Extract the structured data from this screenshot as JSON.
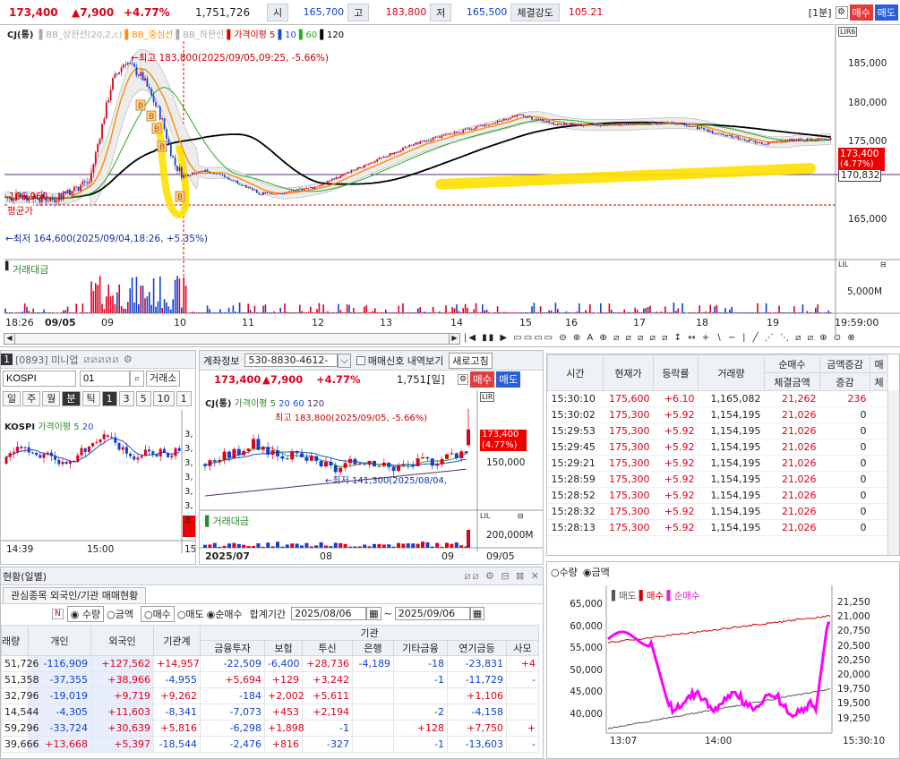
{
  "topbar": {
    "price": "173,400",
    "change": "▲7,900",
    "rate": "+4.77%",
    "volume": "1,751,726",
    "open_label": "시",
    "open": "165,700",
    "high_label": "고",
    "high": "183,800",
    "low_label": "저",
    "low": "165,500",
    "strength_label": "체결강도",
    "strength": "105.21",
    "period": "[1분]",
    "sell_button": "매수",
    "buy_button": "매도"
  },
  "main_chart": {
    "legend_name": "CJ(통)",
    "legend_items": [
      "BB_상한선(20,2,c)",
      "BB_중심선",
      "BB_하한선",
      "가격이평 5",
      "10",
      "60",
      "120"
    ],
    "legend_colors": [
      "#aaaaaa",
      "#ff8c00",
      "#aaaaaa",
      "#e00000",
      "#1a4fd6",
      "#22aa22",
      "#000000"
    ],
    "high_annotation": "←최고 183,800(2025/09/05,09:25, -5.66%)",
    "low_annotation": "←최저 164,600(2025/09/04,18:26, +5.35%)",
    "avg_label": "평균가",
    "price_label_left": "166,960",
    "current_tag": "173,400",
    "current_tag_rate": "(4.77%)",
    "line_tag": "170,832",
    "y_ticks": [
      "185,000",
      "180,000",
      "175,000",
      "165,000"
    ],
    "volume_label": "거래대금",
    "volume_tick": "5,000M",
    "x_labels": [
      "18:26",
      "09/05",
      "09",
      "10",
      "11",
      "12",
      "13",
      "14",
      "15",
      "16",
      "17",
      "18",
      "19",
      "19:59:00"
    ]
  },
  "mini_panel": {
    "title_code": "1",
    "title": "[0893] 미니업",
    "index_input": "KOSPI",
    "code_input": "01",
    "exchange": "거래소",
    "periods": [
      "일",
      "주",
      "월",
      "분",
      "틱",
      "1",
      "3",
      "5",
      "10",
      "1"
    ],
    "legend": "KOSPI",
    "legend_ma": "가격이평 5",
    "legend_ma2": "20",
    "y_values": [
      "3,",
      "3,",
      "3,",
      "3,",
      "3,",
      "3,",
      "3,"
    ],
    "tag": "3,",
    "x_labels": [
      "14:39",
      "15:00",
      "15"
    ]
  },
  "daily_chart": {
    "account_label": "계좌정보",
    "account_number": "530-8830-4612-",
    "signal_checkbox": "매매신호 내역보기",
    "refresh_button": "새로고침",
    "price": "173,400",
    "change": "▲7,900",
    "rate": "+4.77%",
    "volume": "1,751,",
    "period": "[일]",
    "buy": "매수",
    "sell": "매도",
    "legend_name": "CJ(통)",
    "legend_ma": "가격이평 5",
    "legend_ma_vals": [
      "20",
      "60",
      "120"
    ],
    "high_annotation": "최고 183,800(2025/09/05, -5.66%)",
    "low_annotation": "←최저 141,300(2025/08/04,",
    "tag": "173,400",
    "tag_rate": "(4.77%)",
    "y_tick": "150,000",
    "volume_label": "거래대금",
    "volume_tick": "200,000M",
    "x_labels": [
      "2025/07",
      "08",
      "09",
      "09/05"
    ]
  },
  "trade_table": {
    "headers": [
      "시간",
      "현재가",
      "등락률",
      "거래량",
      "순매수",
      "금액증감",
      "매"
    ],
    "subheaders": [
      "체결금액",
      "증감",
      "체"
    ],
    "rows": [
      [
        "15:30:10",
        "175,600",
        "+6.10",
        "1,165,082",
        "21,262",
        "236"
      ],
      [
        "15:30:02",
        "175,300",
        "+5.92",
        "1,154,195",
        "21,026",
        "0"
      ],
      [
        "15:29:53",
        "175,300",
        "+5.92",
        "1,154,195",
        "21,026",
        "0"
      ],
      [
        "15:29:45",
        "175,300",
        "+5.92",
        "1,154,195",
        "21,026",
        "0"
      ],
      [
        "15:29:21",
        "175,300",
        "+5.92",
        "1,154,195",
        "21,026",
        "0"
      ],
      [
        "15:28:59",
        "175,300",
        "+5.92",
        "1,154,195",
        "21,026",
        "0"
      ],
      [
        "15:28:52",
        "175,300",
        "+5.92",
        "1,154,195",
        "21,026",
        "0"
      ],
      [
        "15:28:32",
        "175,300",
        "+5.92",
        "1,154,195",
        "21,026",
        "0"
      ],
      [
        "15:28:13",
        "175,300",
        "+5.92",
        "1,154,195",
        "21,026",
        "0"
      ]
    ]
  },
  "flow_chart": {
    "radio_qty": "수량",
    "radio_amount": "금액",
    "legend": [
      "매도",
      "매수",
      "순매수"
    ],
    "left_ticks": [
      "65,000",
      "60,000",
      "55,000",
      "50,000",
      "45,000",
      "40,000"
    ],
    "right_ticks": [
      "21,250",
      "21,000",
      "20,750",
      "20,500",
      "20,250",
      "20,000",
      "19,750",
      "19,500",
      "19,250"
    ],
    "x_labels": [
      "13:07",
      "14:00",
      "15:30:10"
    ]
  },
  "investor_panel": {
    "title": "현황(일별)",
    "tab": "관심종목 외국인/기관 매매현황",
    "radio_qty": "수량",
    "radio_amount": "금액",
    "radio_buy": "매수",
    "radio_sell": "매도",
    "radio_net": "순매수",
    "period_label": "합계기간",
    "date_from": "2025/08/06",
    "date_to": "2025/09/06",
    "headers": [
      "래량",
      "개인",
      "외국인",
      "기관계",
      "금융투자",
      "보험",
      "투신",
      "은행",
      "기타금융",
      "연기금등",
      "사모"
    ],
    "group_header": "기관",
    "rows": [
      [
        "51,726",
        "-116,909",
        "+127,562",
        "+14,957",
        "-22,509",
        "-6,400",
        "+28,736",
        "-4,189",
        "-18",
        "-23,831",
        "+4"
      ],
      [
        "51,358",
        "-37,355",
        "+38,966",
        "-4,955",
        "+5,694",
        "+129",
        "+3,242",
        "",
        "-1",
        "-11,729",
        "-"
      ],
      [
        "32,796",
        "-19,019",
        "+9,719",
        "+9,262",
        "-184",
        "+2,002",
        "+5,611",
        "",
        "",
        "+1,106",
        ""
      ],
      [
        "14,544",
        "-4,305",
        "+11,603",
        "-8,341",
        "-7,073",
        "+453",
        "+2,194",
        "",
        "-2",
        "-4,158",
        ""
      ],
      [
        "59,296",
        "-33,724",
        "+30,639",
        "+5,816",
        "-6,298",
        "+1,898",
        "-1",
        "",
        "+128",
        "+7,750",
        "+"
      ],
      [
        "39,666",
        "+13,668",
        "+5,397",
        "-18,544",
        "-2,476",
        "+816",
        "-327",
        "",
        "-1",
        "-13,603",
        "-"
      ]
    ]
  },
  "colors": {
    "up": "#e0001b",
    "down": "#1140d0",
    "highlight": "#ffe000",
    "ma_center": "#ff8c00"
  }
}
